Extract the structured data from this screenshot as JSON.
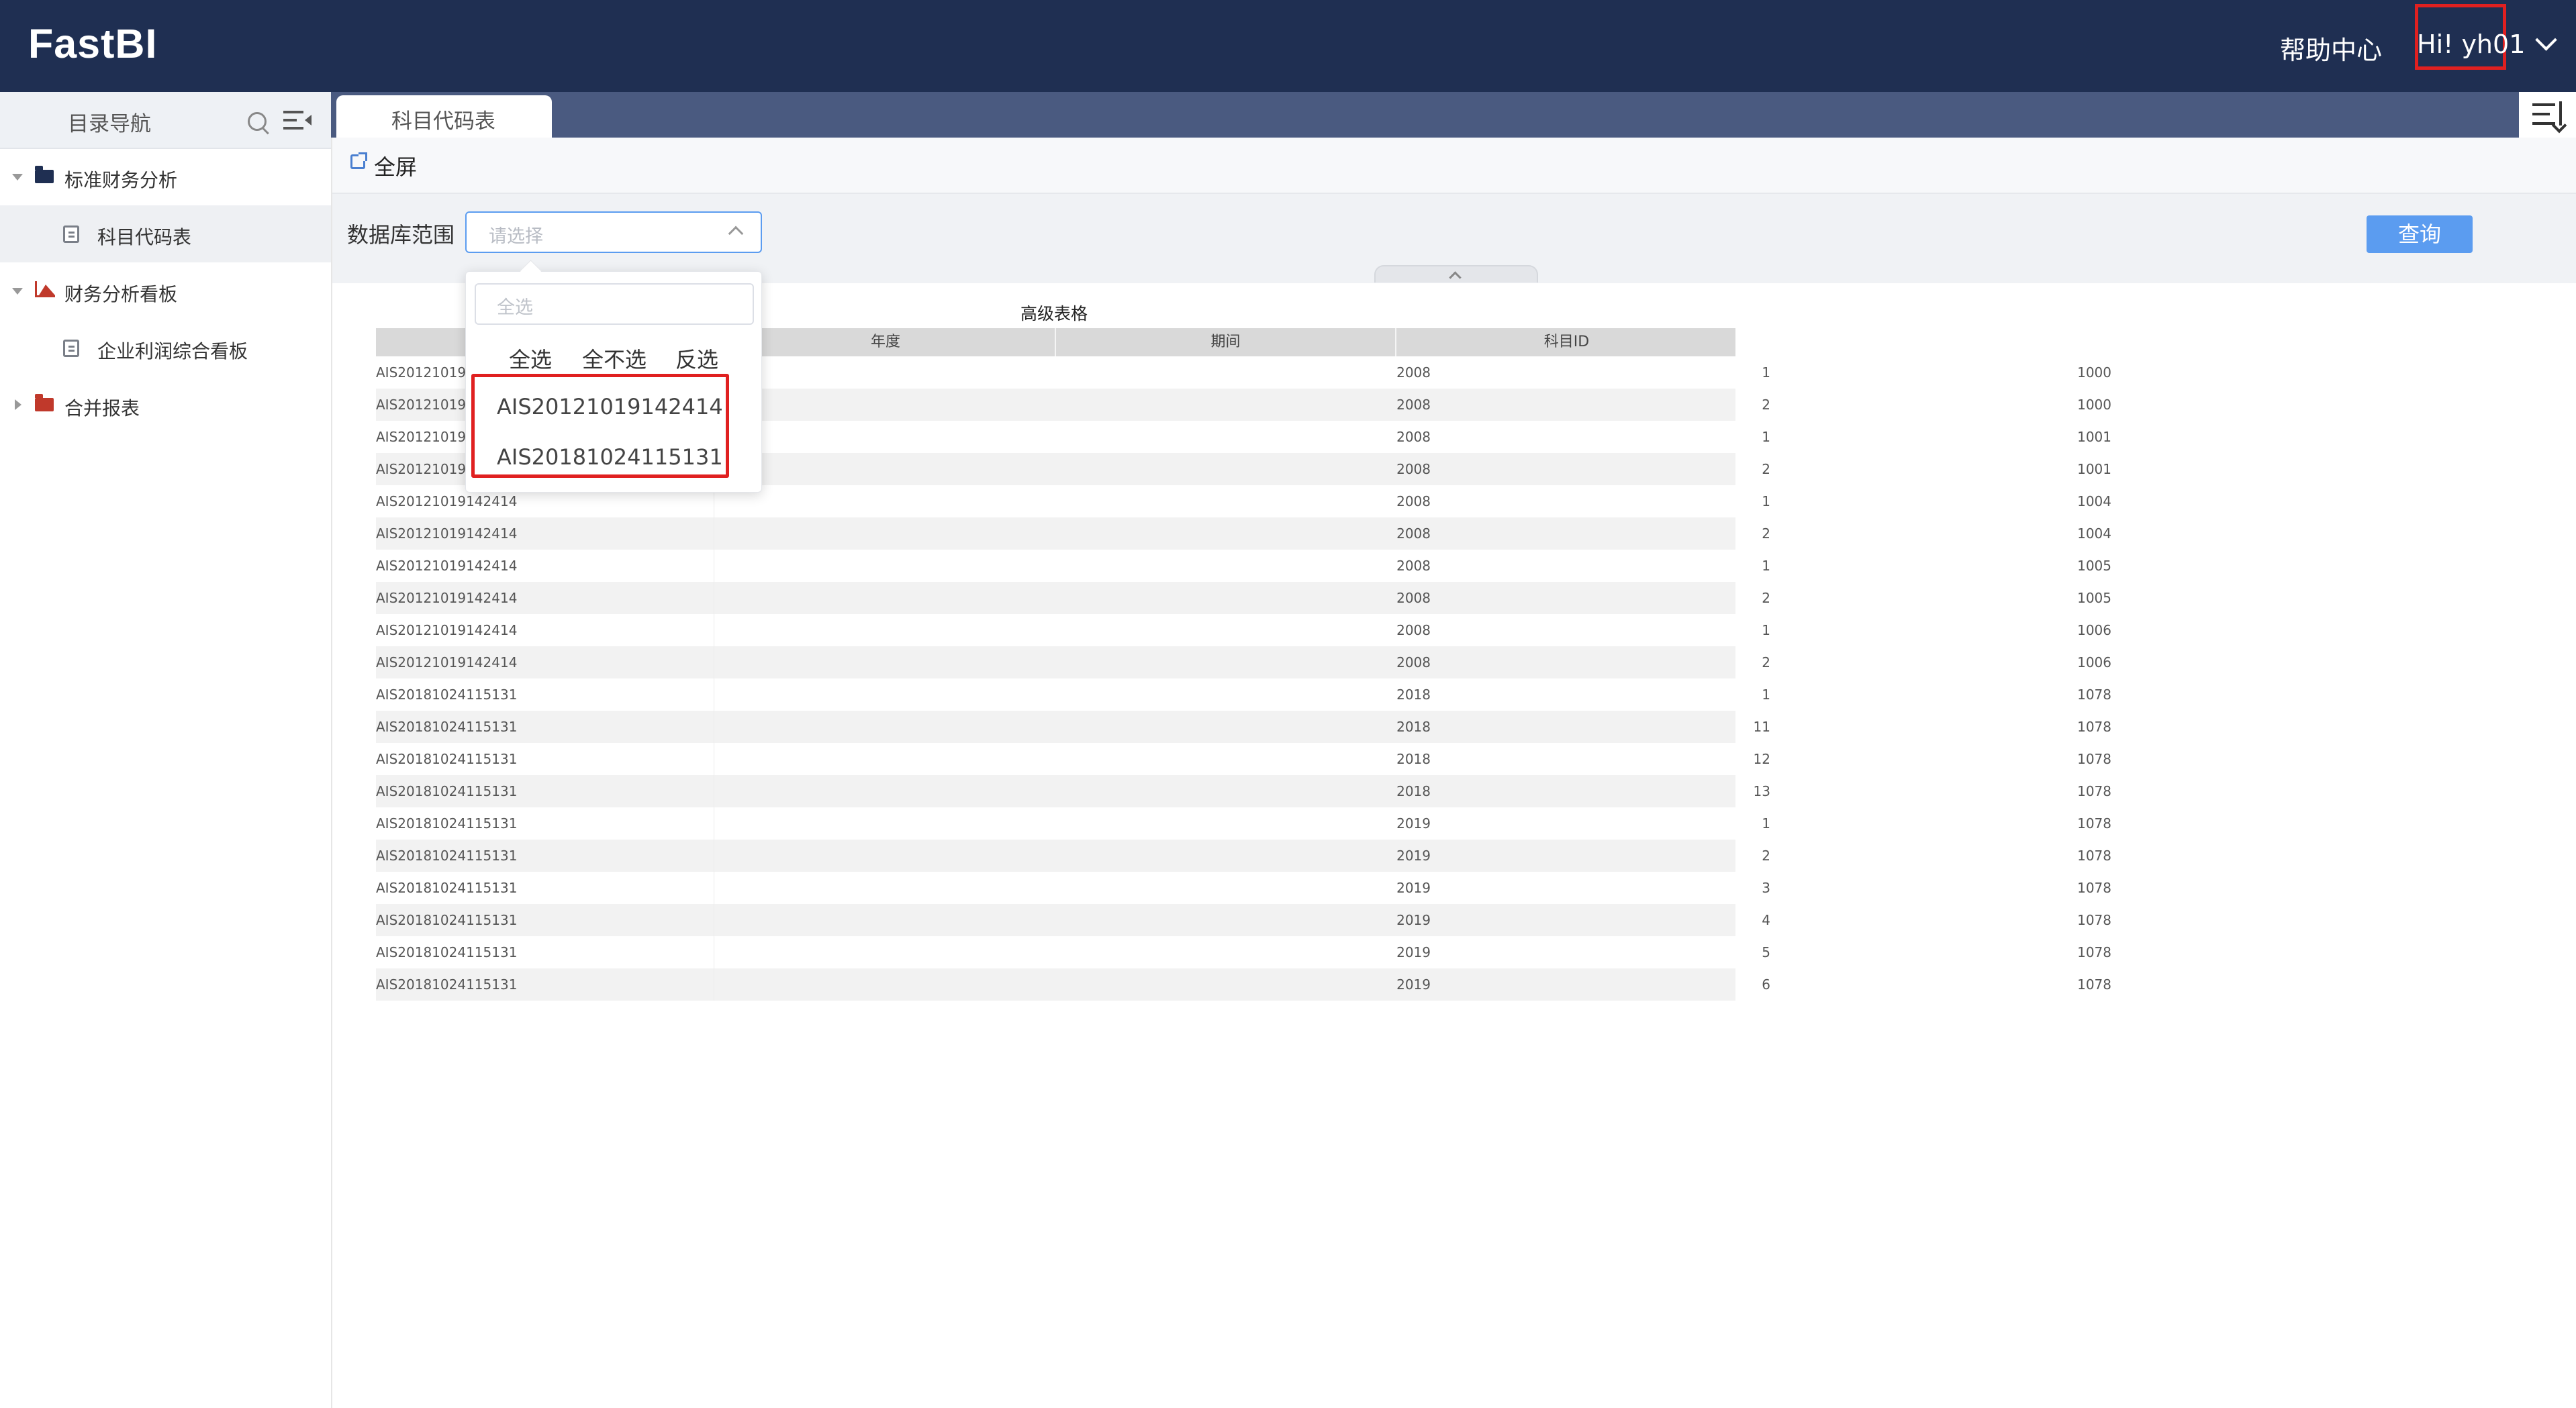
{
  "header": {
    "logo": "FastBI",
    "help": "帮助中心",
    "user": "Hi!  yh01"
  },
  "sidebar": {
    "title": "目录导航",
    "items": [
      {
        "label": "标准财务分析"
      },
      {
        "label": "科目代码表"
      },
      {
        "label": "财务分析看板"
      },
      {
        "label": "企业利润综合看板"
      },
      {
        "label": "合并报表"
      }
    ]
  },
  "tabs": [
    {
      "label": "科目代码表"
    }
  ],
  "toolbar": {
    "fullscreen": "全屏"
  },
  "filter": {
    "label": "数据库范围",
    "placeholder": "请选择",
    "query_button": "查询",
    "dropdown": {
      "search_placeholder": "全选",
      "actions": [
        "全选",
        "全不选",
        "反选"
      ],
      "options": [
        "AIS20121019142414",
        "AIS20181024115131"
      ]
    }
  },
  "table": {
    "title": "高级表格",
    "columns": [
      "",
      "年度",
      "期间",
      "科目ID"
    ],
    "rows": [
      [
        "AIS20121019142414",
        "2008",
        "1",
        "1000"
      ],
      [
        "AIS20121019142414",
        "2008",
        "2",
        "1000"
      ],
      [
        "AIS20121019142414",
        "2008",
        "1",
        "1001"
      ],
      [
        "AIS20121019142414",
        "2008",
        "2",
        "1001"
      ],
      [
        "AIS20121019142414",
        "2008",
        "1",
        "1004"
      ],
      [
        "AIS20121019142414",
        "2008",
        "2",
        "1004"
      ],
      [
        "AIS20121019142414",
        "2008",
        "1",
        "1005"
      ],
      [
        "AIS20121019142414",
        "2008",
        "2",
        "1005"
      ],
      [
        "AIS20121019142414",
        "2008",
        "1",
        "1006"
      ],
      [
        "AIS20121019142414",
        "2008",
        "2",
        "1006"
      ],
      [
        "AIS20181024115131",
        "2018",
        "1",
        "1078"
      ],
      [
        "AIS20181024115131",
        "2018",
        "11",
        "1078"
      ],
      [
        "AIS20181024115131",
        "2018",
        "12",
        "1078"
      ],
      [
        "AIS20181024115131",
        "2018",
        "13",
        "1078"
      ],
      [
        "AIS20181024115131",
        "2019",
        "1",
        "1078"
      ],
      [
        "AIS20181024115131",
        "2019",
        "2",
        "1078"
      ],
      [
        "AIS20181024115131",
        "2019",
        "3",
        "1078"
      ],
      [
        "AIS20181024115131",
        "2019",
        "4",
        "1078"
      ],
      [
        "AIS20181024115131",
        "2019",
        "5",
        "1078"
      ],
      [
        "AIS20181024115131",
        "2019",
        "6",
        "1078"
      ]
    ]
  },
  "colors": {
    "header_bg": "#1f2f52",
    "tab_strip": "#4a5a80",
    "accent": "#5b9cf0",
    "highlight": "#e02020"
  }
}
